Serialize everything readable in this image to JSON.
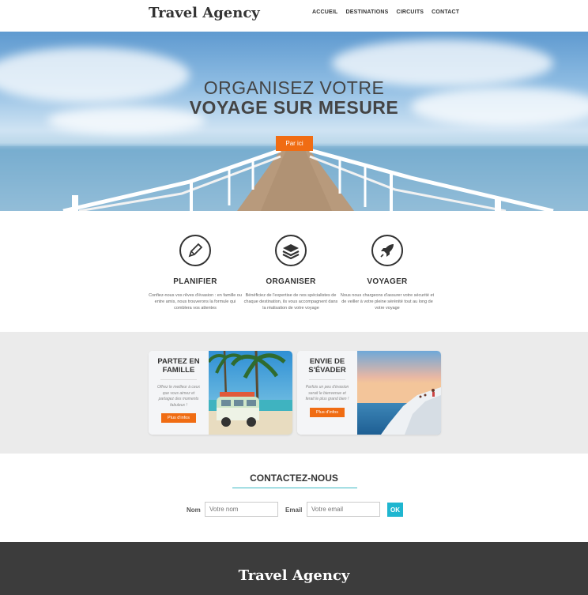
{
  "header": {
    "logo": "Travel Agency",
    "nav": [
      "ACCUEIL",
      "DESTINATIONS",
      "CIRCUITS",
      "CONTACT"
    ]
  },
  "hero": {
    "title_line1": "ORGANISEZ VOTRE",
    "title_line2": "VOYAGE SUR MESURE",
    "cta": "Par ici"
  },
  "features": [
    {
      "icon": "pencil-icon",
      "title": "PLANIFIER",
      "text": "Confiez-nous vos rêves d'évasion : en famille ou entre amis, nous trouverons la formule qui comblera vos attentes"
    },
    {
      "icon": "layers-icon",
      "title": "ORGANISER",
      "text": "Bénéficiez de l'expertise de nos spécialistes de chaque destination, ils vous accompagnent dans la réalisation de votre voyage"
    },
    {
      "icon": "rocket-icon",
      "title": "VOYAGER",
      "text": "Nous nous chargeons d'assurer votre sécurité et de veiller à votre pleine sérénité tout au long de votre voyage"
    }
  ],
  "cards": [
    {
      "title": "PARTEZ EN FAMILLE",
      "text": "Offrez le meilleur à ceux que vous aimez et partagez des moments fabuleux !",
      "button": "Plus d'infos"
    },
    {
      "title": "ENVIE DE S'ÉVADER",
      "text": "Parfois un peu d'évasion serait le bienvenue et ferait le plus grand bien !",
      "button": "Plus d'infos"
    }
  ],
  "contact": {
    "title": "CONTACTEZ-NOUS",
    "name_label": "Nom",
    "name_placeholder": "Votre nom",
    "email_label": "Email",
    "email_placeholder": "Votre email",
    "submit": "OK"
  },
  "footer": {
    "logo": "Travel Agency"
  },
  "colors": {
    "accent": "#f06c13",
    "teal": "#1fb6d0",
    "footer_bg": "#3c3c3c",
    "band_bg": "#ebebeb"
  }
}
